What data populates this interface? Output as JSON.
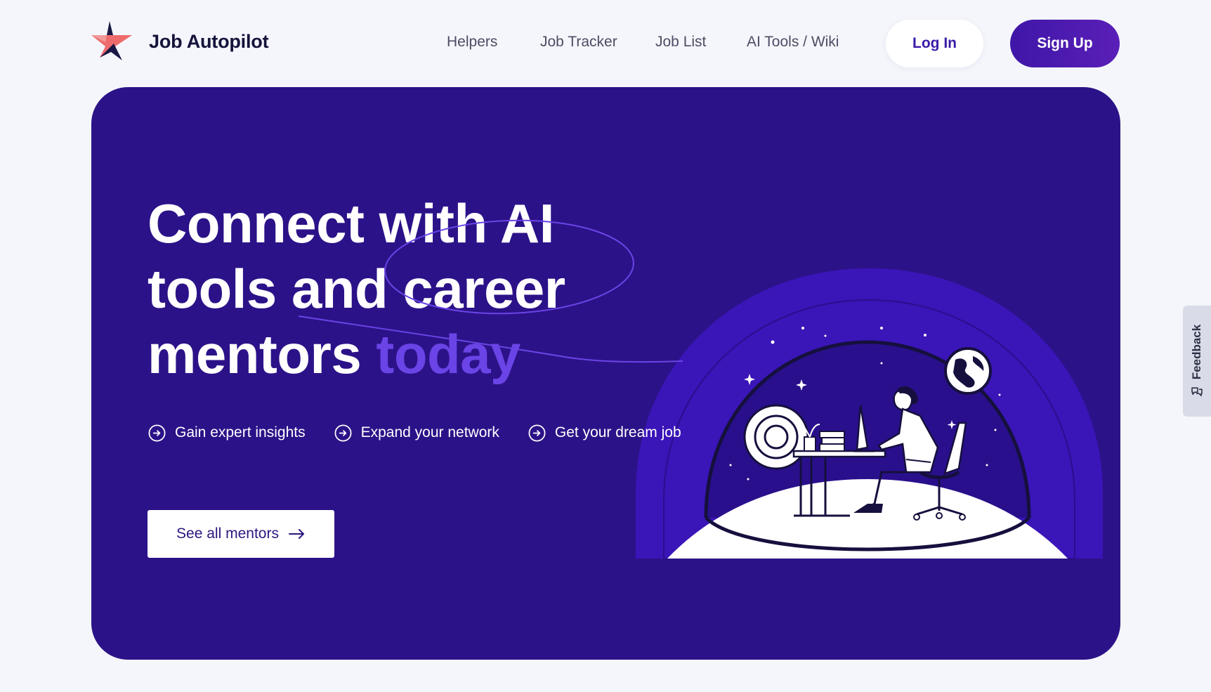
{
  "brand": {
    "name": "Job Autopilot",
    "logo_icon": "star-logo-icon",
    "colors": {
      "accent": "#2c1288",
      "highlight": "#6a44e6",
      "signup": "#4a19ad",
      "logo_red": "#ee6b6b",
      "logo_dark": "#191845"
    }
  },
  "nav": {
    "items": [
      {
        "label": "Helpers"
      },
      {
        "label": "Job Tracker"
      },
      {
        "label": "Job List"
      },
      {
        "label": "AI Tools / Wiki"
      }
    ],
    "login_label": "Log In",
    "signup_label": "Sign Up"
  },
  "hero": {
    "headline_line1": "Connect with AI",
    "headline_line2": "tools and career",
    "headline_line3_main": "mentors",
    "headline_line3_accent": "today",
    "features": [
      {
        "icon": "arrow-circle-icon",
        "label": "Gain expert insights"
      },
      {
        "icon": "arrow-circle-icon",
        "label": "Expand your network"
      },
      {
        "icon": "arrow-circle-icon",
        "label": "Get your dream job"
      }
    ],
    "cta_label": "See all mentors",
    "cta_icon": "arrow-right-icon",
    "illustration": "person-working-in-space-dome-illustration"
  },
  "feedback": {
    "label": "Feedback",
    "icon": "feedback-icon"
  }
}
